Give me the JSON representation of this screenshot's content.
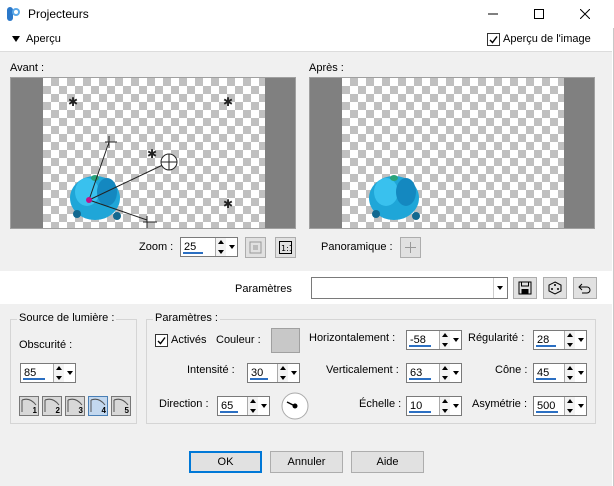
{
  "window": {
    "title": "Projecteurs"
  },
  "apercu": {
    "label": "Aperçu",
    "image_label": "Aperçu de l'image",
    "image_checked": true
  },
  "preview": {
    "before_label": "Avant :",
    "after_label": "Après :"
  },
  "zoom": {
    "label": "Zoom :",
    "value": "25",
    "pan_label": "Panoramique :"
  },
  "params_bar": {
    "label": "Paramètres",
    "value": ""
  },
  "light_source": {
    "group_title": "Source de lumière :",
    "darkness_label": "Obscurité :",
    "darkness_value": "85",
    "lights": [
      "1",
      "2",
      "3",
      "4",
      "5"
    ],
    "selected_light": "4"
  },
  "parameters": {
    "group_title": "Paramètres :",
    "active_label": "Activés",
    "active_checked": true,
    "color_label": "Couleur :",
    "color_value": "#c8c8c8",
    "intensity_label": "Intensité :",
    "intensity_value": "30",
    "direction_label": "Direction :",
    "direction_value": "65",
    "horizontal_label": "Horizontalement :",
    "horizontal_value": "-58",
    "vertical_label": "Verticalement :",
    "vertical_value": "63",
    "scale_label": "Échelle :",
    "scale_value": "10",
    "regularity_label": "Régularité :",
    "regularity_value": "28",
    "cone_label": "Cône :",
    "cone_value": "45",
    "asymmetry_label": "Asymétrie :",
    "asymmetry_value": "500"
  },
  "buttons": {
    "ok": "OK",
    "cancel": "Annuler",
    "help": "Aide"
  },
  "colors": {
    "accent": "#0078d7",
    "preview_object": "#1fa6d8"
  }
}
